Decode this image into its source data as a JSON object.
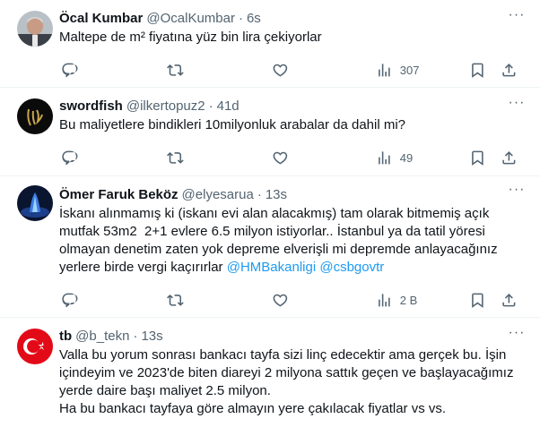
{
  "tweets": [
    {
      "name": "Öcal Kumbar",
      "handle": "@OcalKumbar",
      "time": "6s",
      "text": "Maltepe de m² fiyatına yüz bin lira çekiyorlar",
      "views": "307",
      "avatar": "profile-photo-man"
    },
    {
      "name": "swordfish",
      "handle": "@ilkertopuz2",
      "time": "41d",
      "text": "Bu maliyetlere bindikleri 10milyonluk arabalar da dahil mi?",
      "views": "49",
      "avatar": "gold-logo-on-black"
    },
    {
      "name": "Ömer Faruk Beköz",
      "handle": "@elyesarua",
      "time": "13s",
      "text": "İskanı alınmamış ki (iskanı evi alan alacakmış) tam olarak bitmemiş açık mutfak 53m2  2+1 evlere 6.5 milyon istiyorlar.. İstanbul ya da tatil yöresi olmayan denetim zaten yok depreme elverişli mi depremde anlayacağınız yerlere birde vergi kaçırırlar ",
      "mentions": [
        "@HMBakanligi",
        "@csbgovtr"
      ],
      "views": "2 B",
      "avatar": "blue-fountain-photo"
    },
    {
      "name": "tb",
      "handle": "@b_tekn",
      "time": "13s",
      "text": "Valla bu yorum sonrası bankacı tayfa sizi linç edecektir ama gerçek bu. İşin içindeyim ve 2023'de biten diareyi 2 milyona sattık geçen ve başlayacağımız yerde daire başı maliyet 2.5 milyon.\nHa bu bankacı tayfaya göre almayın yere çakılacak fiyatlar vs vs.",
      "avatar": "turkish-flag"
    }
  ],
  "colors": {
    "secondary_text": "#536471",
    "link": "#1d9bf0",
    "divider": "#eff3f4",
    "flag_red": "#e30a17"
  }
}
